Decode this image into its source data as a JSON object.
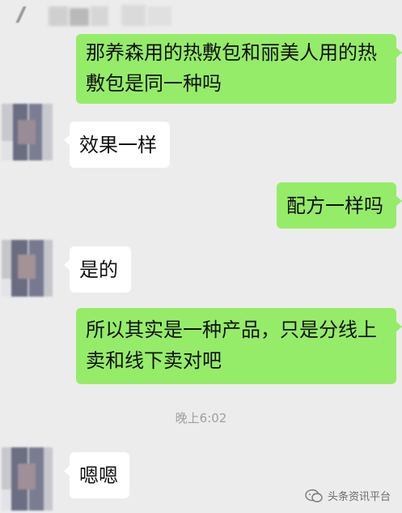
{
  "messages": [
    {
      "from": "me",
      "text": "那养森用的热敷包和丽美人用的热敷包是同一种吗"
    },
    {
      "from": "them",
      "text": "效果一样"
    },
    {
      "from": "me",
      "text": "配方一样吗"
    },
    {
      "from": "them",
      "text": "是的"
    },
    {
      "from": "me",
      "text": "所以其实是一种产品，只是分线上卖和线下卖对吧"
    },
    {
      "from": "them",
      "text": "嗯嗯"
    }
  ],
  "timestamp": "晚上6:02",
  "watermark": {
    "text": "头条资讯平台",
    "icon": "chat-bubble-icon"
  },
  "colors": {
    "background": "#ececec",
    "outgoing_bubble": "#95ec69",
    "incoming_bubble": "#ffffff",
    "timestamp": "#9e9e9e"
  }
}
